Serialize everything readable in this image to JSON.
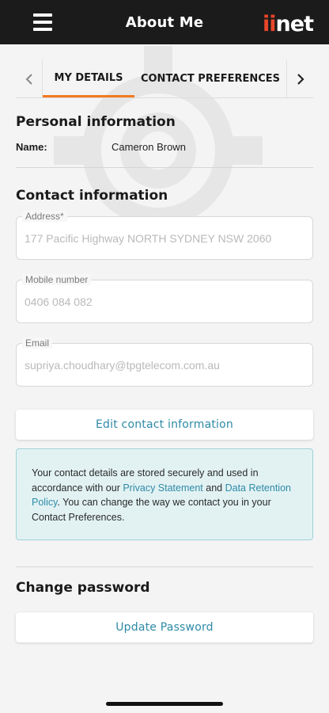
{
  "header": {
    "title": "About Me",
    "logo_ii": "ii",
    "logo_net": "net"
  },
  "tabs": {
    "items": [
      {
        "label": "MY DETAILS",
        "active": true
      },
      {
        "label": "CONTACT PREFERENCES",
        "active": false
      }
    ],
    "prev_icon": "chevron-left-icon",
    "next_icon": "chevron-right-icon"
  },
  "personal": {
    "title": "Personal information",
    "name_label": "Name:",
    "name_value": "Cameron Brown"
  },
  "contact": {
    "title": "Contact information",
    "fields": [
      {
        "label": "Address*",
        "value": "177 Pacific Highway NORTH SYDNEY NSW 2060"
      },
      {
        "label": "Mobile number",
        "value": "0406 084 082"
      },
      {
        "label": "Email",
        "value": "supriya.choudhary@tpgtelecom.com.au"
      }
    ],
    "edit_button": "Edit contact information"
  },
  "notice": {
    "text_1": "Your contact details are stored securely and used in accordance with our ",
    "link_privacy": "Privacy Statement",
    "text_2": " and ",
    "link_retention": "Data Retention Policy",
    "text_3": ". You can change the way we contact you in your Contact Preferences."
  },
  "password": {
    "title": "Change password",
    "button": "Update Password"
  },
  "colors": {
    "header_bg": "#1b1b1b",
    "accent_orange": "#f47a20",
    "link_teal": "#2e8aa6",
    "notice_bg": "#e2f2f3",
    "logo_red": "#e8452a"
  }
}
